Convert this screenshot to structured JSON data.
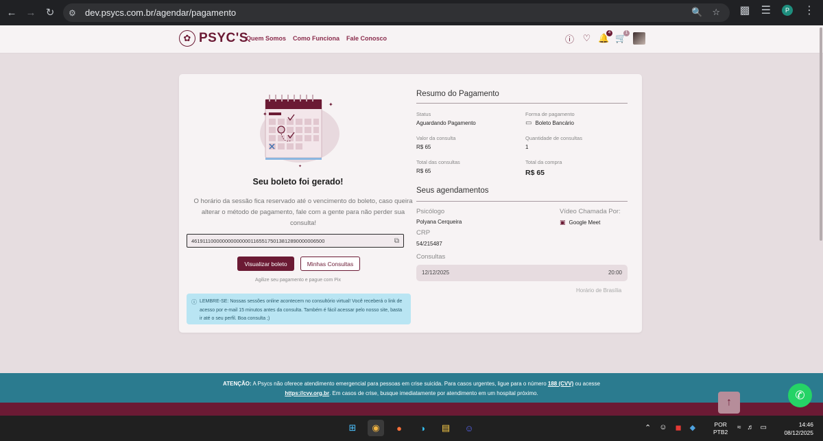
{
  "browser": {
    "url": "dev.psycs.com.br/agendar/pagamento",
    "profile_initial": "P"
  },
  "header": {
    "logo_text": "PSYC'S",
    "nav": [
      "Quem Somos",
      "Como Funciona",
      "Fale Conosco"
    ],
    "notification_count": "4",
    "cart_count": "1"
  },
  "left": {
    "title": "Seu boleto foi gerado!",
    "description": "O horário da sessão fica reservado até o vencimento do boleto, caso queira alterar o método de pagamento, fale com a gente para não perder sua consulta!",
    "barcode": "46191110000000000000011655175013812890000006500",
    "btn_view": "Visualizar boleto",
    "btn_appointments": "Minhas Consultas",
    "pix_note": "Agilize seu pagamento e pague com Pix",
    "reminder": "LEMBRE-SE: Nossas sessões online acontecem no consultório virtual! Você receberá o link de acesso por e-mail 15 minutos antes da consulta. Também é fácil acessar pelo nosso site, basta ir até o seu perfil. Boa consulta ;)"
  },
  "summary": {
    "title": "Resumo do Pagamento",
    "status_label": "Status",
    "status_value": "Aguardando Pagamento",
    "method_label": "Forma de pagamento",
    "method_value": "Boleto Bancário",
    "price_label": "Valor da consulta",
    "price_value": "R$ 65",
    "qty_label": "Quantidade de consultas",
    "qty_value": "1",
    "total_consult_label": "Total das consultas",
    "total_consult_value": "R$ 65",
    "total_label": "Total da compra",
    "total_value": "R$ 65"
  },
  "appointments": {
    "title": "Seus agendamentos",
    "psych_label": "Psicólogo",
    "psych_value": "Polyana Cerqueira",
    "video_label": "Vídeo Chamada Por:",
    "video_value": "Google Meet",
    "crp_label": "CRP",
    "crp_value": "54/215487",
    "consults_label": "Consultas",
    "date": "12/12/2025",
    "time": "20:00",
    "timezone": "Horário de Brasília"
  },
  "footer": {
    "warn_prefix": "ATENÇÃO:",
    "warn_text1": "A Psycs não oferece atendimento emergencial para pessoas em crise suicida. Para casos urgentes, ligue para o número",
    "cvv_number": "188 (CVV)",
    "warn_text2": "ou acesse",
    "cvv_link": "https://cvv.org.br",
    "warn_text3": ". Em casos de crise, busque imediatamente por atendimento em um hospital próximo."
  },
  "taskbar": {
    "lang_line1": "POR",
    "lang_line2": "PTB2",
    "time": "14:46",
    "date": "08/12/2025"
  },
  "colors": {
    "brand": "#6b1a34",
    "teal_bar": "#2b7b8f",
    "reminder_bg": "#b9e5f3"
  }
}
